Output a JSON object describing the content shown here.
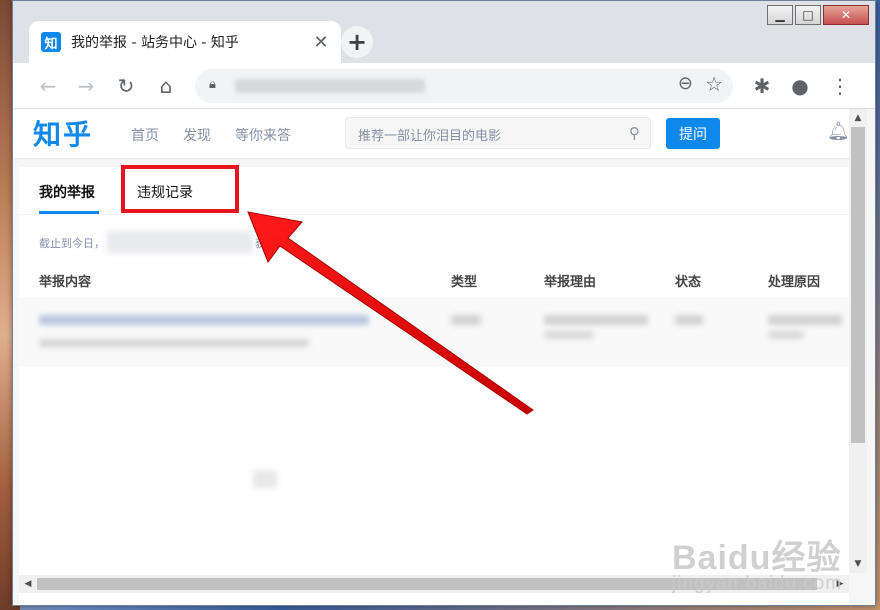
{
  "browser": {
    "tab": {
      "favicon": "知",
      "title": "我的举报 - 站务中心 - 知乎"
    },
    "new_tab": "+",
    "window_controls": {
      "minimize": "▁",
      "maximize": "□",
      "close": "✕"
    }
  },
  "site": {
    "logo": "知乎",
    "nav": [
      "首页",
      "发现",
      "等你来答"
    ],
    "search_placeholder": "推荐一部让你泪目的电影",
    "ask_button": "提问"
  },
  "page": {
    "tabs": [
      {
        "label": "我的举报",
        "active": true
      },
      {
        "label": "违规记录",
        "active": false
      }
    ],
    "notice_prefix": "截止到今日，",
    "notice_suffix": "获",
    "table_headers": [
      "举报内容",
      "类型",
      "举报理由",
      "状态",
      "处理原因"
    ]
  },
  "colors": {
    "accent": "#0f88eb",
    "annotation_red": "#e8141c"
  },
  "watermark": {
    "logo": "Baidu经验",
    "sub": "jingyan.baidu.com"
  }
}
